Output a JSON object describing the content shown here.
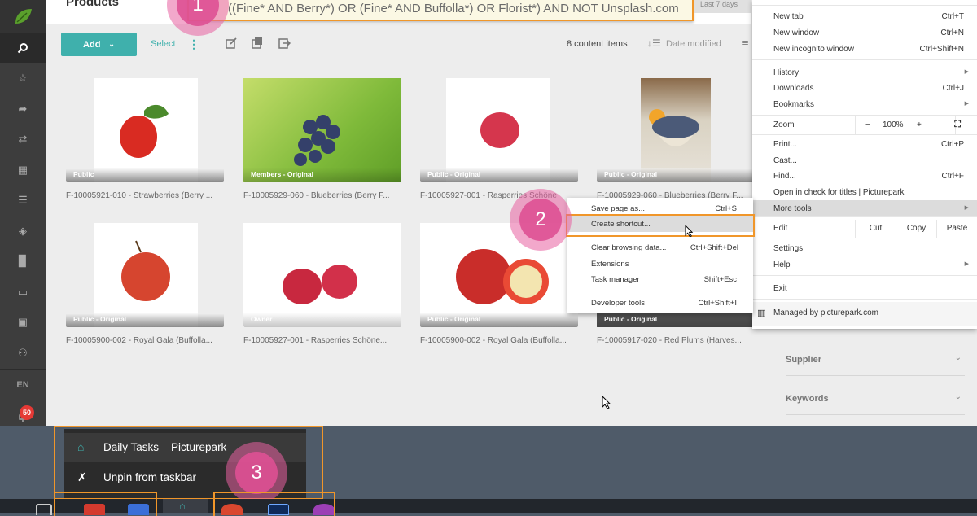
{
  "header": {
    "title": "Products",
    "search_query": "((Fine* AND Berry*) OR (Fine* AND Buffolla*) OR Florist*) AND NOT Unsplash.com",
    "date_filter": "Last 7 days"
  },
  "sidebar": {
    "items": [
      {
        "icon": "search-icon",
        "glyph": "⌕"
      },
      {
        "icon": "star-icon",
        "glyph": "☆"
      },
      {
        "icon": "share-icon",
        "glyph": "➦"
      },
      {
        "icon": "transfer-icon",
        "glyph": "⇄"
      },
      {
        "icon": "grid-icon",
        "glyph": "▦"
      },
      {
        "icon": "list-icon",
        "glyph": "☰"
      },
      {
        "icon": "layers-icon",
        "glyph": "◈"
      },
      {
        "icon": "document-icon",
        "glyph": "▉"
      },
      {
        "icon": "card-icon",
        "glyph": "▭"
      },
      {
        "icon": "wallet-icon",
        "glyph": "▣"
      },
      {
        "icon": "user-check-icon",
        "glyph": "⚇"
      }
    ],
    "language": "EN",
    "notification_count": "50"
  },
  "toolbar": {
    "add_label": "Add",
    "select_label": "Select",
    "item_count": "8 content items",
    "sort_label": "Date modified"
  },
  "items": [
    {
      "badge": "Public",
      "caption": "F-10005921-010 - Strawberries (Berry ..."
    },
    {
      "badge": "Members - Original",
      "caption": "F-10005929-060 - Blueberries (Berry F..."
    },
    {
      "badge": "Public - Original",
      "caption": "F-10005927-001 - Rasperries Schöne"
    },
    {
      "badge": "Public - Original",
      "caption": "F-10005929-060 - Blueberries (Berry F..."
    },
    {
      "badge": "Public - Original",
      "caption": "F-10005900-002 - Royal Gala (Buffolla..."
    },
    {
      "badge": "Owner",
      "caption": "F-10005927-001 - Rasperries Schöne..."
    },
    {
      "badge": "Public - Original",
      "caption": "F-10005900-002 - Royal Gala (Buffolla..."
    },
    {
      "badge": "Public - Original",
      "caption": "F-10005917-020 - Red Plums (Harves..."
    }
  ],
  "facets": [
    {
      "label": "Supplier"
    },
    {
      "label": "Keywords"
    }
  ],
  "chrome_menu": {
    "new_tab": {
      "label": "New tab",
      "shortcut": "Ctrl+T"
    },
    "new_window": {
      "label": "New window",
      "shortcut": "Ctrl+N"
    },
    "new_incognito": {
      "label": "New incognito window",
      "shortcut": "Ctrl+Shift+N"
    },
    "history": {
      "label": "History"
    },
    "downloads": {
      "label": "Downloads",
      "shortcut": "Ctrl+J"
    },
    "bookmarks": {
      "label": "Bookmarks"
    },
    "zoom": {
      "label": "Zoom",
      "minus": "−",
      "value": "100%",
      "plus": "+"
    },
    "print": {
      "label": "Print...",
      "shortcut": "Ctrl+P"
    },
    "cast": {
      "label": "Cast..."
    },
    "find": {
      "label": "Find...",
      "shortcut": "Ctrl+F"
    },
    "open_in": {
      "label": "Open in check for titles | Picturepark"
    },
    "more_tools": {
      "label": "More tools"
    },
    "edit": {
      "label": "Edit",
      "cut": "Cut",
      "copy": "Copy",
      "paste": "Paste"
    },
    "settings": {
      "label": "Settings"
    },
    "help": {
      "label": "Help"
    },
    "exit": {
      "label": "Exit"
    },
    "managed": {
      "label": "Managed by picturepark.com"
    }
  },
  "more_tools_menu": {
    "save_page": {
      "label": "Save page as...",
      "shortcut": "Ctrl+S"
    },
    "create_shortcut": {
      "label": "Create shortcut..."
    },
    "clear_data": {
      "label": "Clear browsing data...",
      "shortcut": "Ctrl+Shift+Del"
    },
    "extensions": {
      "label": "Extensions"
    },
    "task_manager": {
      "label": "Task manager",
      "shortcut": "Shift+Esc"
    },
    "dev_tools": {
      "label": "Developer tools",
      "shortcut": "Ctrl+Shift+I"
    }
  },
  "steps": {
    "one": "1",
    "two": "2",
    "three": "3"
  },
  "jumplist": {
    "app": "Daily Tasks _ Picturepark",
    "unpin": "Unpin from taskbar"
  },
  "colors": {
    "accent": "#3fb0ac",
    "highlight": "#f0962a",
    "step_marker": "#de5094",
    "badge": "#e53935"
  }
}
